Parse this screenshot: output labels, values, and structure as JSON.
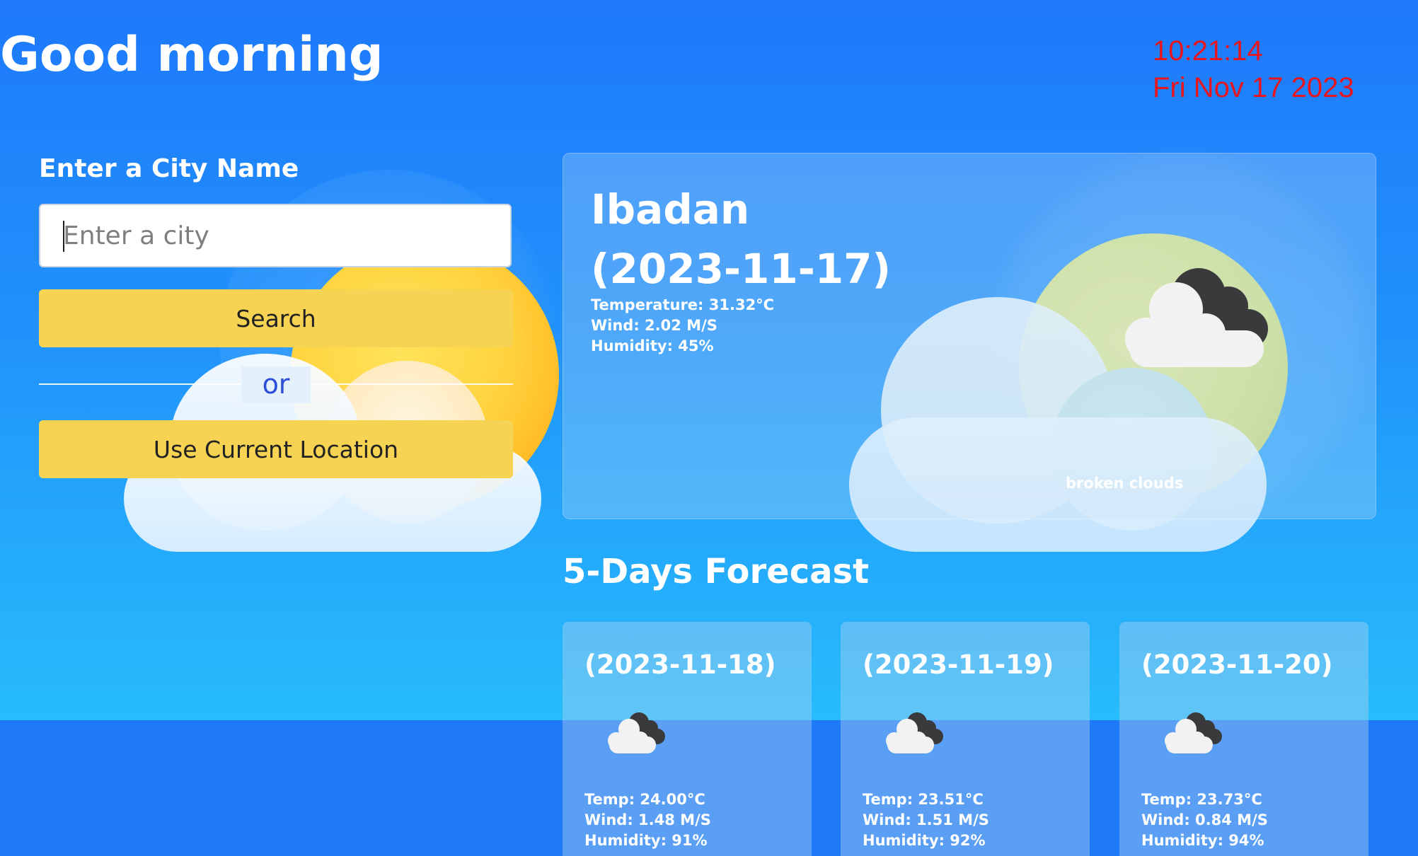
{
  "header": {
    "greeting": "Good morning",
    "time": "10:21:14",
    "date": "Fri Nov 17 2023",
    "clock_color": "#e8151d"
  },
  "search": {
    "label": "Enter a City Name",
    "placeholder": "Enter a city",
    "value": "",
    "search_button": "Search",
    "or_label": "or",
    "location_button": "Use Current Location",
    "button_color": "#f7d353"
  },
  "current": {
    "city": "Ibadan",
    "date": "(2023-11-17)",
    "temperature": "Temperature: 31.32°C",
    "wind": "Wind: 2.02 M/S",
    "humidity": "Humidity: 45%",
    "description": "broken clouds",
    "icon": "broken-clouds-icon"
  },
  "forecast": {
    "title": "5-Days Forecast",
    "days": [
      {
        "date": "(2023-11-18)",
        "temp": "Temp: 24.00°C",
        "wind": "Wind: 1.48 M/S",
        "humidity": "Humidity: 91%",
        "icon": "broken-clouds-icon"
      },
      {
        "date": "(2023-11-19)",
        "temp": "Temp: 23.51°C",
        "wind": "Wind: 1.51 M/S",
        "humidity": "Humidity: 92%",
        "icon": "broken-clouds-icon"
      },
      {
        "date": "(2023-11-20)",
        "temp": "Temp: 23.73°C",
        "wind": "Wind: 0.84 M/S",
        "humidity": "Humidity: 94%",
        "icon": "broken-clouds-icon"
      }
    ]
  },
  "theme": {
    "background_top": "#1e79fb",
    "background_bottom": "#29c6fb"
  }
}
